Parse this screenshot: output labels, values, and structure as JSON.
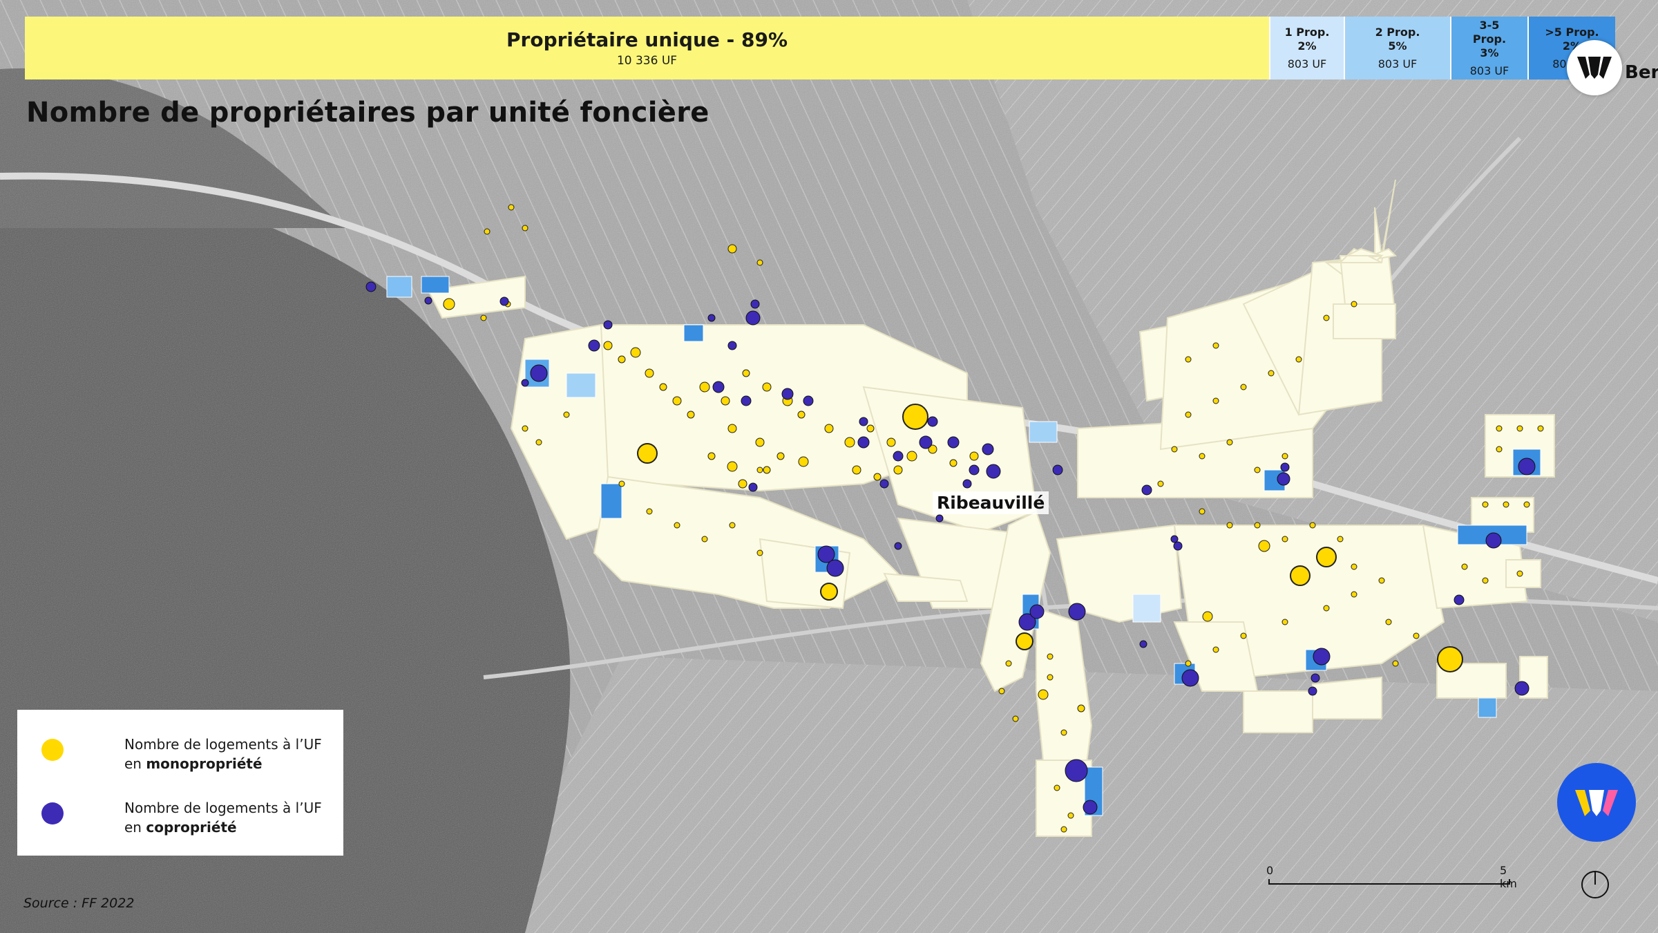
{
  "map": {
    "title": "Nombre de propriétaires par unité foncière",
    "place_label": "Ribeauvillé",
    "source": "Source : FF 2022",
    "scale": {
      "start": "0",
      "end": "5 km"
    }
  },
  "ownership_bar": [
    {
      "label": "Propriétaire unique - 89%",
      "count": "10 336 UF",
      "color": "#fcf77a"
    },
    {
      "label": "1 Prop.\n2%",
      "count": "803 UF",
      "color": "#cde6fb"
    },
    {
      "label": "2 Prop.\n5%",
      "count": "803 UF",
      "color": "#a3d2f7"
    },
    {
      "label": "3-5\nProp.\n3%",
      "count": "803 UF",
      "color": "#5aa9ea"
    },
    {
      "label": ">5 Prop.\n2%",
      "count": "803 UF",
      "color": "#3a8fe0"
    }
  ],
  "legend": {
    "mono": {
      "line1": "Nombre de logements à l’UF",
      "line2_prefix": "en ",
      "line2_bold": "monopropriété",
      "color": "#ffd900"
    },
    "copro": {
      "line1": "Nombre de logements à l’UF",
      "line2_prefix": "en ",
      "line2_bold": "copropriété",
      "color": "#3d2bb5"
    }
  },
  "brand": {
    "text_partial": "Bere"
  }
}
